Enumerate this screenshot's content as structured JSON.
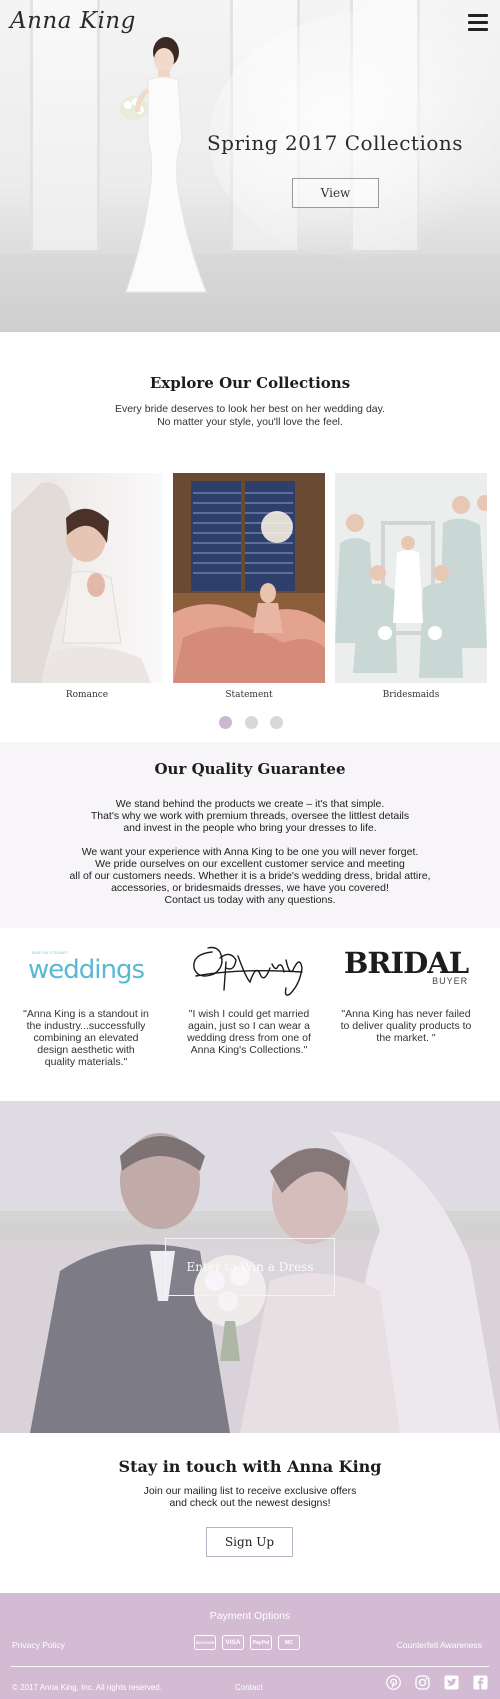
{
  "header": {
    "brand": "Anna King",
    "menu_icon": "hamburger-menu-icon"
  },
  "hero": {
    "title": "Spring 2017 Collections",
    "button_label": "View"
  },
  "explore": {
    "title": "Explore Our Collections",
    "lines": [
      "Every bride deserves to look her best on her wedding day.",
      "No matter your style, you'll love the feel."
    ],
    "collections": [
      {
        "label": "Romance"
      },
      {
        "label": "Statement"
      },
      {
        "label": "Bridesmaids"
      }
    ],
    "carousel": {
      "pages": 3,
      "active_index": 0
    }
  },
  "quality": {
    "title": "Our Quality Guarantee",
    "paragraph1": [
      "We stand behind the products we create – it's that simple.",
      "That's why we work with premium threads, oversee the littlest details",
      "and invest in the people who bring your dresses to life."
    ],
    "paragraph2": [
      "We want your experience with Anna King to be one you will never forget.",
      "We pride ourselves on our excellent customer service and meeting",
      "all of our customers needs. Whether it is a bride's wedding dress, bridal attire,",
      "accessories, or bridesmaids dresses, we have you covered!",
      "Contact us today with any questions."
    ]
  },
  "press": [
    {
      "logo_small": "MARTHA STEWART",
      "logo": "weddings",
      "quote_lines": [
        "\"Anna King is a standout in",
        "the industry...successfully",
        "combining an elevated",
        "design aesthetic with",
        "quality materials.\""
      ]
    },
    {
      "logo": "Oprah Winfrey",
      "quote_lines": [
        "\"I wish I could get married",
        "again, just so I can wear a",
        "wedding dress from one of",
        "Anna King's Collections.\""
      ]
    },
    {
      "logo": "BRIDAL",
      "logo_sub": "BUYER",
      "quote_lines": [
        "\"Anna King has never failed",
        "to deliver quality products to",
        "the market. \""
      ]
    }
  ],
  "contest": {
    "button_label": "Enter to Win a Dress"
  },
  "newsletter": {
    "title": "Stay in touch with Anna King",
    "lines": [
      "Join our mailing list to receive exclusive offers",
      "and check out the newest designs!"
    ],
    "button_label": "Sign Up"
  },
  "footer": {
    "payment_title": "Payment Options",
    "privacy": "Privacy Policy",
    "counterfeit": "Counterfeit Awareness",
    "cards": [
      "DISCOVER",
      "VISA",
      "PayPal",
      "MC"
    ],
    "copyright": "© 2017 Anna King, Inc. All rights reserved.",
    "contact": "Contact",
    "social": [
      "pinterest-icon",
      "instagram-icon",
      "twitter-icon",
      "facebook-icon"
    ]
  },
  "colors": {
    "accent_purple": "#d3bbd3",
    "dot_active": "#cbb8d0",
    "dot_inactive": "#d8d8d8",
    "weddings_blue": "#5bb8d2",
    "quality_bg": "#f7f5f8"
  }
}
